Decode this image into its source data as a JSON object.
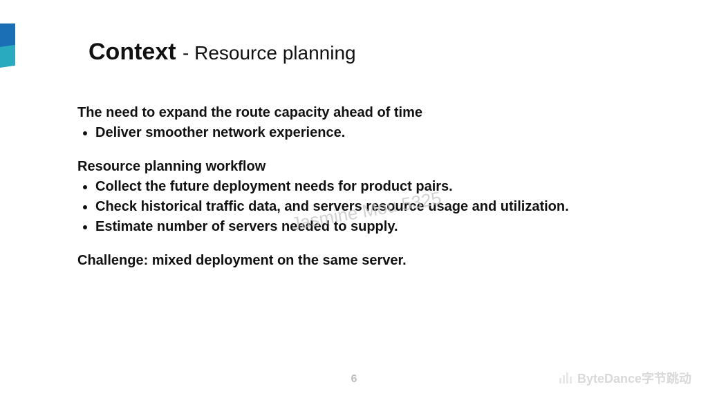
{
  "title": {
    "strong": "Context",
    "sub": " - Resource planning"
  },
  "sections": {
    "first_heading": "The need to expand the route capacity ahead of time",
    "first_bullets": [
      "Deliver smoother network experience."
    ],
    "second_heading": "Resource planning workflow",
    "second_bullets": [
      "Collect the future deployment needs for product pairs.",
      "Check historical traffic data, and servers resource usage and utilization.",
      "Estimate number of servers needed to supply."
    ],
    "challenge": "Challenge: mixed deployment on the same server."
  },
  "watermark": "Jasmine Mou 5325",
  "page_number": "6",
  "brand": "ByteDance字节跳动"
}
